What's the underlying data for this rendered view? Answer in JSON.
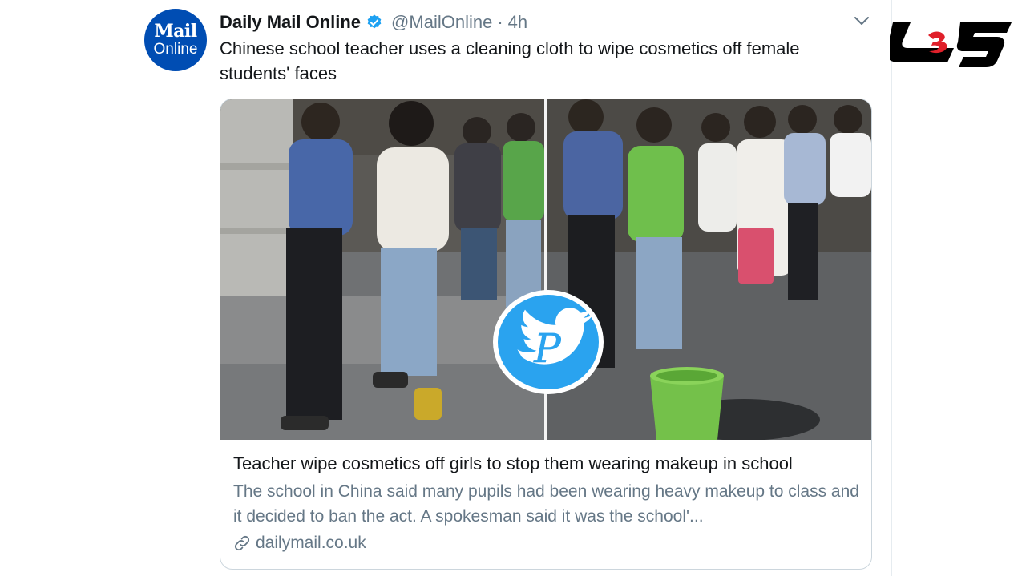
{
  "tweet": {
    "avatar": {
      "line1": "Mail",
      "line2": "Online"
    },
    "display_name": "Daily Mail Online",
    "handle": "@MailOnline",
    "separator": "·",
    "timestamp": "4h",
    "text": "Chinese school teacher uses a cleaning cloth to wipe cosmetics off female students' faces",
    "verified_icon": "verified-badge-icon",
    "menu_icon": "chevron-down-icon"
  },
  "card": {
    "title": "Teacher wipe cosmetics off girls to stop them wearing makeup in school",
    "description": "The school in China said many pupils had been wearing heavy makeup to class and it decided to ban the act. A spokesman said it was the school'...",
    "domain": "dailymail.co.uk",
    "link_icon": "link-icon"
  },
  "overlay": {
    "watermark_icon": "twitter-bird-watermark-icon"
  },
  "site_logo": {
    "icon": "site-logo-icon"
  },
  "colors": {
    "avatar_bg": "#004db3",
    "verified": "#1da1f2",
    "text_primary": "#14171a",
    "text_secondary": "#657786",
    "logo_red": "#e0202a",
    "watermark_blue": "#2aa3ef"
  }
}
